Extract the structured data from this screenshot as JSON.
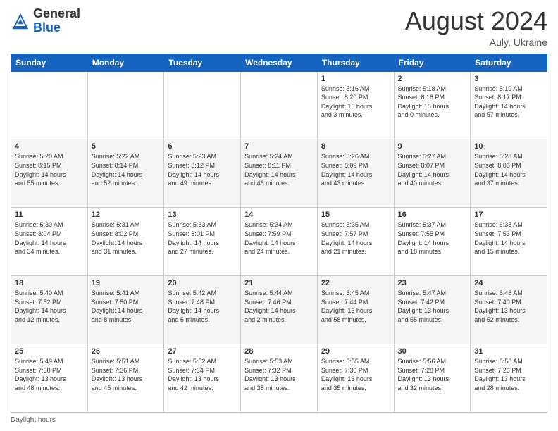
{
  "header": {
    "logo_general": "General",
    "logo_blue": "Blue",
    "month_title": "August 2024",
    "location": "Auly, Ukraine"
  },
  "days_of_week": [
    "Sunday",
    "Monday",
    "Tuesday",
    "Wednesday",
    "Thursday",
    "Friday",
    "Saturday"
  ],
  "footer_label": "Daylight hours",
  "weeks": [
    [
      {
        "day": "",
        "info": ""
      },
      {
        "day": "",
        "info": ""
      },
      {
        "day": "",
        "info": ""
      },
      {
        "day": "",
        "info": ""
      },
      {
        "day": "1",
        "info": "Sunrise: 5:16 AM\nSunset: 8:20 PM\nDaylight: 15 hours\nand 3 minutes."
      },
      {
        "day": "2",
        "info": "Sunrise: 5:18 AM\nSunset: 8:18 PM\nDaylight: 15 hours\nand 0 minutes."
      },
      {
        "day": "3",
        "info": "Sunrise: 5:19 AM\nSunset: 8:17 PM\nDaylight: 14 hours\nand 57 minutes."
      }
    ],
    [
      {
        "day": "4",
        "info": "Sunrise: 5:20 AM\nSunset: 8:15 PM\nDaylight: 14 hours\nand 55 minutes."
      },
      {
        "day": "5",
        "info": "Sunrise: 5:22 AM\nSunset: 8:14 PM\nDaylight: 14 hours\nand 52 minutes."
      },
      {
        "day": "6",
        "info": "Sunrise: 5:23 AM\nSunset: 8:12 PM\nDaylight: 14 hours\nand 49 minutes."
      },
      {
        "day": "7",
        "info": "Sunrise: 5:24 AM\nSunset: 8:11 PM\nDaylight: 14 hours\nand 46 minutes."
      },
      {
        "day": "8",
        "info": "Sunrise: 5:26 AM\nSunset: 8:09 PM\nDaylight: 14 hours\nand 43 minutes."
      },
      {
        "day": "9",
        "info": "Sunrise: 5:27 AM\nSunset: 8:07 PM\nDaylight: 14 hours\nand 40 minutes."
      },
      {
        "day": "10",
        "info": "Sunrise: 5:28 AM\nSunset: 8:06 PM\nDaylight: 14 hours\nand 37 minutes."
      }
    ],
    [
      {
        "day": "11",
        "info": "Sunrise: 5:30 AM\nSunset: 8:04 PM\nDaylight: 14 hours\nand 34 minutes."
      },
      {
        "day": "12",
        "info": "Sunrise: 5:31 AM\nSunset: 8:02 PM\nDaylight: 14 hours\nand 31 minutes."
      },
      {
        "day": "13",
        "info": "Sunrise: 5:33 AM\nSunset: 8:01 PM\nDaylight: 14 hours\nand 27 minutes."
      },
      {
        "day": "14",
        "info": "Sunrise: 5:34 AM\nSunset: 7:59 PM\nDaylight: 14 hours\nand 24 minutes."
      },
      {
        "day": "15",
        "info": "Sunrise: 5:35 AM\nSunset: 7:57 PM\nDaylight: 14 hours\nand 21 minutes."
      },
      {
        "day": "16",
        "info": "Sunrise: 5:37 AM\nSunset: 7:55 PM\nDaylight: 14 hours\nand 18 minutes."
      },
      {
        "day": "17",
        "info": "Sunrise: 5:38 AM\nSunset: 7:53 PM\nDaylight: 14 hours\nand 15 minutes."
      }
    ],
    [
      {
        "day": "18",
        "info": "Sunrise: 5:40 AM\nSunset: 7:52 PM\nDaylight: 14 hours\nand 12 minutes."
      },
      {
        "day": "19",
        "info": "Sunrise: 5:41 AM\nSunset: 7:50 PM\nDaylight: 14 hours\nand 8 minutes."
      },
      {
        "day": "20",
        "info": "Sunrise: 5:42 AM\nSunset: 7:48 PM\nDaylight: 14 hours\nand 5 minutes."
      },
      {
        "day": "21",
        "info": "Sunrise: 5:44 AM\nSunset: 7:46 PM\nDaylight: 14 hours\nand 2 minutes."
      },
      {
        "day": "22",
        "info": "Sunrise: 5:45 AM\nSunset: 7:44 PM\nDaylight: 13 hours\nand 58 minutes."
      },
      {
        "day": "23",
        "info": "Sunrise: 5:47 AM\nSunset: 7:42 PM\nDaylight: 13 hours\nand 55 minutes."
      },
      {
        "day": "24",
        "info": "Sunrise: 5:48 AM\nSunset: 7:40 PM\nDaylight: 13 hours\nand 52 minutes."
      }
    ],
    [
      {
        "day": "25",
        "info": "Sunrise: 5:49 AM\nSunset: 7:38 PM\nDaylight: 13 hours\nand 48 minutes."
      },
      {
        "day": "26",
        "info": "Sunrise: 5:51 AM\nSunset: 7:36 PM\nDaylight: 13 hours\nand 45 minutes."
      },
      {
        "day": "27",
        "info": "Sunrise: 5:52 AM\nSunset: 7:34 PM\nDaylight: 13 hours\nand 42 minutes."
      },
      {
        "day": "28",
        "info": "Sunrise: 5:53 AM\nSunset: 7:32 PM\nDaylight: 13 hours\nand 38 minutes."
      },
      {
        "day": "29",
        "info": "Sunrise: 5:55 AM\nSunset: 7:30 PM\nDaylight: 13 hours\nand 35 minutes."
      },
      {
        "day": "30",
        "info": "Sunrise: 5:56 AM\nSunset: 7:28 PM\nDaylight: 13 hours\nand 32 minutes."
      },
      {
        "day": "31",
        "info": "Sunrise: 5:58 AM\nSunset: 7:26 PM\nDaylight: 13 hours\nand 28 minutes."
      }
    ]
  ]
}
